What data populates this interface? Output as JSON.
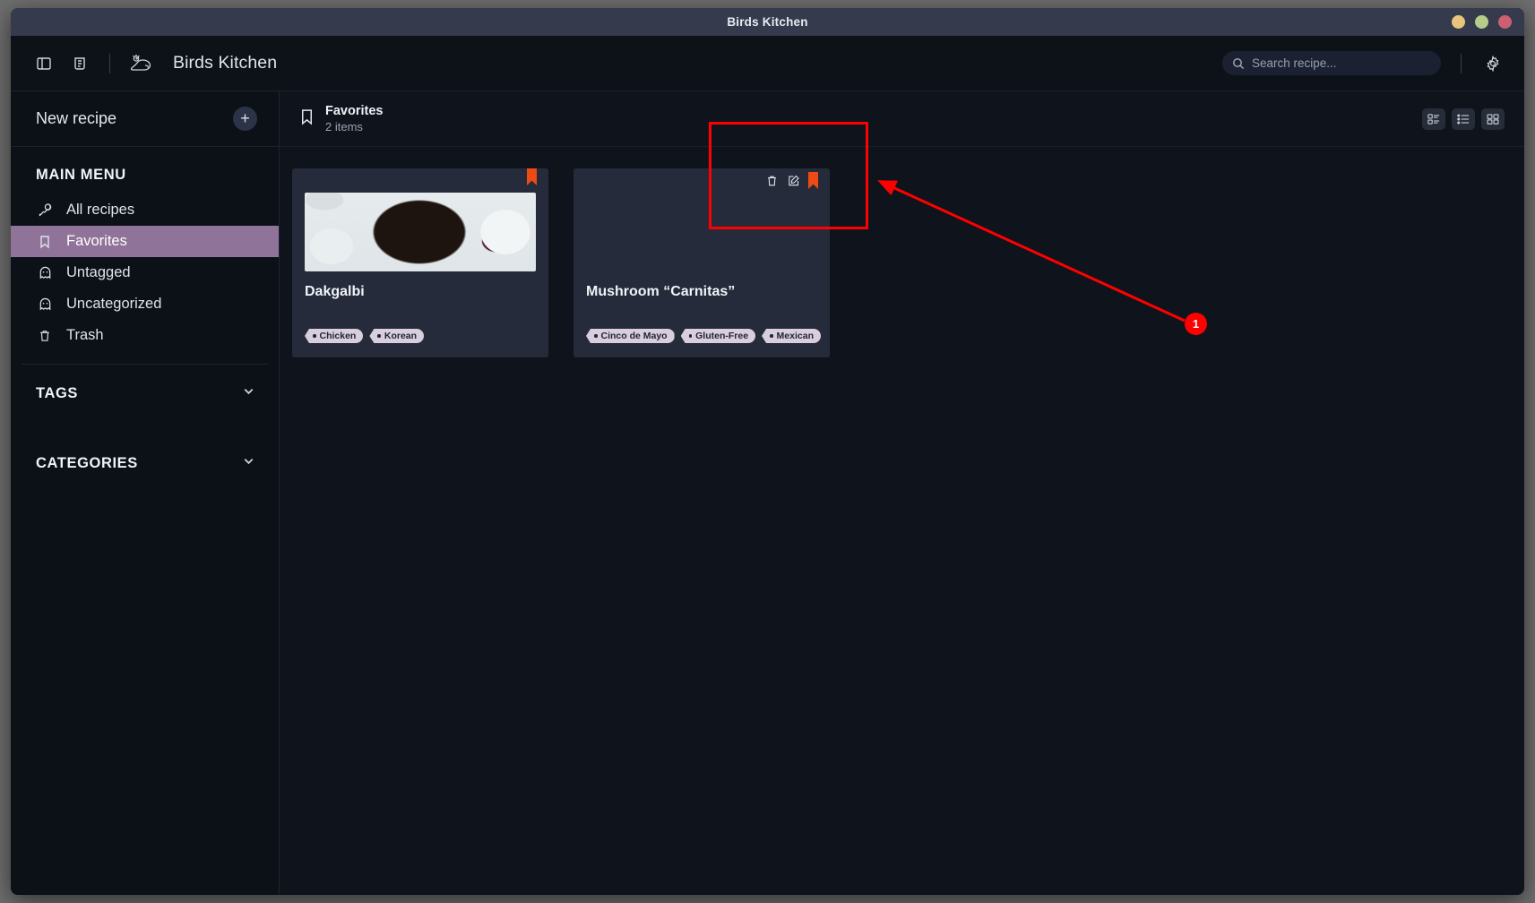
{
  "window": {
    "title": "Birds Kitchen",
    "controls": [
      {
        "name": "minimize",
        "color": "#e8c57a"
      },
      {
        "name": "maximize",
        "color": "#b5cc8a"
      },
      {
        "name": "close",
        "color": "#cc5f72"
      }
    ]
  },
  "header": {
    "sidebar_toggle_icon": "panel-left-icon",
    "notes_icon": "measuring-cup-icon",
    "logo_icon": "bird-logo-icon",
    "app_name": "Birds Kitchen",
    "search": {
      "icon": "search-icon",
      "placeholder": "Search recipe...",
      "value": ""
    },
    "settings_icon": "gear-icon"
  },
  "sidebar": {
    "new_recipe_label": "New recipe",
    "add_icon": "plus-icon",
    "main_menu_title": "MAIN MENU",
    "items": [
      {
        "label": "All recipes",
        "icon": "drumstick-icon",
        "active": false
      },
      {
        "label": "Favorites",
        "icon": "bookmark-icon",
        "active": true
      },
      {
        "label": "Untagged",
        "icon": "ghost-icon",
        "active": false
      },
      {
        "label": "Uncategorized",
        "icon": "ghost-icon",
        "active": false
      },
      {
        "label": "Trash",
        "icon": "trash-icon",
        "active": false
      }
    ],
    "collapsibles": [
      {
        "label": "TAGS",
        "icon": "chevron-down-icon"
      },
      {
        "label": "CATEGORIES",
        "icon": "chevron-down-icon"
      }
    ],
    "active_color": "#8f7398"
  },
  "main": {
    "header": {
      "icon": "bookmark-icon",
      "title": "Favorites",
      "subtitle": "2 items"
    },
    "view_modes": [
      {
        "name": "detail-view",
        "icon": "detail-list-icon",
        "selected": false
      },
      {
        "name": "list-view",
        "icon": "list-icon",
        "selected": false
      },
      {
        "name": "grid-view",
        "icon": "grid-icon",
        "selected": false
      }
    ],
    "cards": [
      {
        "title": "Dakgalbi",
        "thumb_class": "thumb-dakgalbi",
        "bookmarked": true,
        "bookmark_color": "#ef4a13",
        "hovered": false,
        "tags": [
          "Chicken",
          "Korean"
        ],
        "actions": []
      },
      {
        "title": "Mushroom “Carnitas”",
        "thumb_class": "thumb-mushroom",
        "bookmarked": true,
        "bookmark_color": "#ef4a13",
        "hovered": true,
        "tags": [
          "Cinco de Mayo",
          "Gluten-Free",
          "Mexican"
        ],
        "actions": [
          {
            "name": "delete-recipe",
            "icon": "trash-icon"
          },
          {
            "name": "edit-recipe",
            "icon": "edit-pencil-icon"
          }
        ]
      }
    ]
  },
  "annotation": {
    "badge_label": "1",
    "color": "#ff0000"
  }
}
